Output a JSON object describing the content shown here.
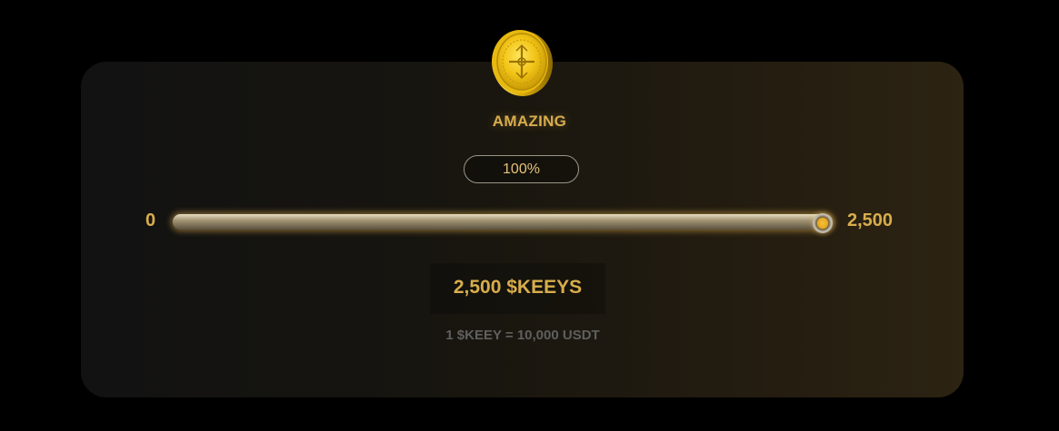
{
  "tier": {
    "label": "AMAZING",
    "icon": "gold-coin-icon",
    "coin_color": "#f2c417"
  },
  "progress": {
    "percent_label": "100%",
    "percent_value": 1.0
  },
  "slider": {
    "min_label": "0",
    "max_label": "2,500",
    "min": 0,
    "max": 2500,
    "value": 2500
  },
  "amount": {
    "label": "2,500 $KEEYS"
  },
  "rate": {
    "label": "1 $KEEY = 10,000 USDT"
  },
  "colors": {
    "accent": "#d8ad4c",
    "background": "#000000",
    "card_left": "#121212",
    "card_right": "#2c2312",
    "muted_text": "#5f5f5f"
  }
}
